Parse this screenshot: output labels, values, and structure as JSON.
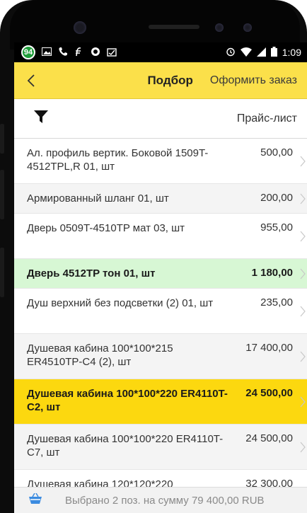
{
  "status_bar": {
    "notification_count": "94",
    "time": "1:09"
  },
  "navbar": {
    "title": "Подбор",
    "action": "Оформить заказ"
  },
  "toolbar": {
    "price_list": "Прайс-лист"
  },
  "items": [
    {
      "name": "Ал. профиль вертик. Боковой 1509T-4512TPL,R 01, шт",
      "price": "500,00",
      "style": "normal"
    },
    {
      "name": "Армированный шланг 01, шт",
      "price": "200,00",
      "style": "alt"
    },
    {
      "name": "Дверь 0509T-4510TP мат 03, шт",
      "price": "955,00",
      "style": "normal"
    },
    {
      "name": "Дверь 4512TP тон 01, шт",
      "price": "1 180,00",
      "style": "green"
    },
    {
      "name": "Душ верхний без подсветки (2) 01, шт",
      "price": "235,00",
      "style": "normal"
    },
    {
      "name": "Душевая кабина 100*100*215 ER4510TP-C4  (2), шт",
      "price": "17 400,00",
      "style": "alt"
    },
    {
      "name": "Душевая кабина 100*100*220 ER4110T-C2, шт",
      "price": "24 500,00",
      "style": "yellow"
    },
    {
      "name": "Душевая кабина 100*100*220 ER4110T-C7, шт",
      "price": "24 500,00",
      "style": "alt"
    },
    {
      "name": "Душевая кабина 120*120*220",
      "price": "32 300,00",
      "style": "normal"
    }
  ],
  "footer": {
    "summary": "Выбрано 2 поз. на сумму 79 400,00 RUB"
  },
  "colors": {
    "accent": "#fbe04a",
    "selected": "#fcd80f",
    "highlight": "#d7f7d4"
  },
  "icons": {
    "back": "chevron-left-icon",
    "filter": "filter-icon",
    "basket": "basket-icon",
    "row_chevron": "chevron-right-icon"
  }
}
